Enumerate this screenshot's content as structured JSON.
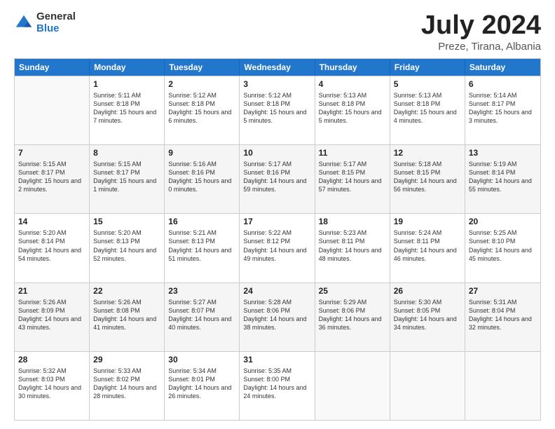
{
  "header": {
    "logo_general": "General",
    "logo_blue": "Blue",
    "title": "July 2024",
    "location": "Preze, Tirana, Albania"
  },
  "days_of_week": [
    "Sunday",
    "Monday",
    "Tuesday",
    "Wednesday",
    "Thursday",
    "Friday",
    "Saturday"
  ],
  "weeks": [
    [
      {
        "day": "",
        "sunrise": "",
        "sunset": "",
        "daylight": ""
      },
      {
        "day": "1",
        "sunrise": "Sunrise: 5:11 AM",
        "sunset": "Sunset: 8:18 PM",
        "daylight": "Daylight: 15 hours and 7 minutes."
      },
      {
        "day": "2",
        "sunrise": "Sunrise: 5:12 AM",
        "sunset": "Sunset: 8:18 PM",
        "daylight": "Daylight: 15 hours and 6 minutes."
      },
      {
        "day": "3",
        "sunrise": "Sunrise: 5:12 AM",
        "sunset": "Sunset: 8:18 PM",
        "daylight": "Daylight: 15 hours and 5 minutes."
      },
      {
        "day": "4",
        "sunrise": "Sunrise: 5:13 AM",
        "sunset": "Sunset: 8:18 PM",
        "daylight": "Daylight: 15 hours and 5 minutes."
      },
      {
        "day": "5",
        "sunrise": "Sunrise: 5:13 AM",
        "sunset": "Sunset: 8:18 PM",
        "daylight": "Daylight: 15 hours and 4 minutes."
      },
      {
        "day": "6",
        "sunrise": "Sunrise: 5:14 AM",
        "sunset": "Sunset: 8:17 PM",
        "daylight": "Daylight: 15 hours and 3 minutes."
      }
    ],
    [
      {
        "day": "7",
        "sunrise": "Sunrise: 5:15 AM",
        "sunset": "Sunset: 8:17 PM",
        "daylight": "Daylight: 15 hours and 2 minutes."
      },
      {
        "day": "8",
        "sunrise": "Sunrise: 5:15 AM",
        "sunset": "Sunset: 8:17 PM",
        "daylight": "Daylight: 15 hours and 1 minute."
      },
      {
        "day": "9",
        "sunrise": "Sunrise: 5:16 AM",
        "sunset": "Sunset: 8:16 PM",
        "daylight": "Daylight: 15 hours and 0 minutes."
      },
      {
        "day": "10",
        "sunrise": "Sunrise: 5:17 AM",
        "sunset": "Sunset: 8:16 PM",
        "daylight": "Daylight: 14 hours and 59 minutes."
      },
      {
        "day": "11",
        "sunrise": "Sunrise: 5:17 AM",
        "sunset": "Sunset: 8:15 PM",
        "daylight": "Daylight: 14 hours and 57 minutes."
      },
      {
        "day": "12",
        "sunrise": "Sunrise: 5:18 AM",
        "sunset": "Sunset: 8:15 PM",
        "daylight": "Daylight: 14 hours and 56 minutes."
      },
      {
        "day": "13",
        "sunrise": "Sunrise: 5:19 AM",
        "sunset": "Sunset: 8:14 PM",
        "daylight": "Daylight: 14 hours and 55 minutes."
      }
    ],
    [
      {
        "day": "14",
        "sunrise": "Sunrise: 5:20 AM",
        "sunset": "Sunset: 8:14 PM",
        "daylight": "Daylight: 14 hours and 54 minutes."
      },
      {
        "day": "15",
        "sunrise": "Sunrise: 5:20 AM",
        "sunset": "Sunset: 8:13 PM",
        "daylight": "Daylight: 14 hours and 52 minutes."
      },
      {
        "day": "16",
        "sunrise": "Sunrise: 5:21 AM",
        "sunset": "Sunset: 8:13 PM",
        "daylight": "Daylight: 14 hours and 51 minutes."
      },
      {
        "day": "17",
        "sunrise": "Sunrise: 5:22 AM",
        "sunset": "Sunset: 8:12 PM",
        "daylight": "Daylight: 14 hours and 49 minutes."
      },
      {
        "day": "18",
        "sunrise": "Sunrise: 5:23 AM",
        "sunset": "Sunset: 8:11 PM",
        "daylight": "Daylight: 14 hours and 48 minutes."
      },
      {
        "day": "19",
        "sunrise": "Sunrise: 5:24 AM",
        "sunset": "Sunset: 8:11 PM",
        "daylight": "Daylight: 14 hours and 46 minutes."
      },
      {
        "day": "20",
        "sunrise": "Sunrise: 5:25 AM",
        "sunset": "Sunset: 8:10 PM",
        "daylight": "Daylight: 14 hours and 45 minutes."
      }
    ],
    [
      {
        "day": "21",
        "sunrise": "Sunrise: 5:26 AM",
        "sunset": "Sunset: 8:09 PM",
        "daylight": "Daylight: 14 hours and 43 minutes."
      },
      {
        "day": "22",
        "sunrise": "Sunrise: 5:26 AM",
        "sunset": "Sunset: 8:08 PM",
        "daylight": "Daylight: 14 hours and 41 minutes."
      },
      {
        "day": "23",
        "sunrise": "Sunrise: 5:27 AM",
        "sunset": "Sunset: 8:07 PM",
        "daylight": "Daylight: 14 hours and 40 minutes."
      },
      {
        "day": "24",
        "sunrise": "Sunrise: 5:28 AM",
        "sunset": "Sunset: 8:06 PM",
        "daylight": "Daylight: 14 hours and 38 minutes."
      },
      {
        "day": "25",
        "sunrise": "Sunrise: 5:29 AM",
        "sunset": "Sunset: 8:06 PM",
        "daylight": "Daylight: 14 hours and 36 minutes."
      },
      {
        "day": "26",
        "sunrise": "Sunrise: 5:30 AM",
        "sunset": "Sunset: 8:05 PM",
        "daylight": "Daylight: 14 hours and 34 minutes."
      },
      {
        "day": "27",
        "sunrise": "Sunrise: 5:31 AM",
        "sunset": "Sunset: 8:04 PM",
        "daylight": "Daylight: 14 hours and 32 minutes."
      }
    ],
    [
      {
        "day": "28",
        "sunrise": "Sunrise: 5:32 AM",
        "sunset": "Sunset: 8:03 PM",
        "daylight": "Daylight: 14 hours and 30 minutes."
      },
      {
        "day": "29",
        "sunrise": "Sunrise: 5:33 AM",
        "sunset": "Sunset: 8:02 PM",
        "daylight": "Daylight: 14 hours and 28 minutes."
      },
      {
        "day": "30",
        "sunrise": "Sunrise: 5:34 AM",
        "sunset": "Sunset: 8:01 PM",
        "daylight": "Daylight: 14 hours and 26 minutes."
      },
      {
        "day": "31",
        "sunrise": "Sunrise: 5:35 AM",
        "sunset": "Sunset: 8:00 PM",
        "daylight": "Daylight: 14 hours and 24 minutes."
      },
      {
        "day": "",
        "sunrise": "",
        "sunset": "",
        "daylight": ""
      },
      {
        "day": "",
        "sunrise": "",
        "sunset": "",
        "daylight": ""
      },
      {
        "day": "",
        "sunrise": "",
        "sunset": "",
        "daylight": ""
      }
    ]
  ]
}
